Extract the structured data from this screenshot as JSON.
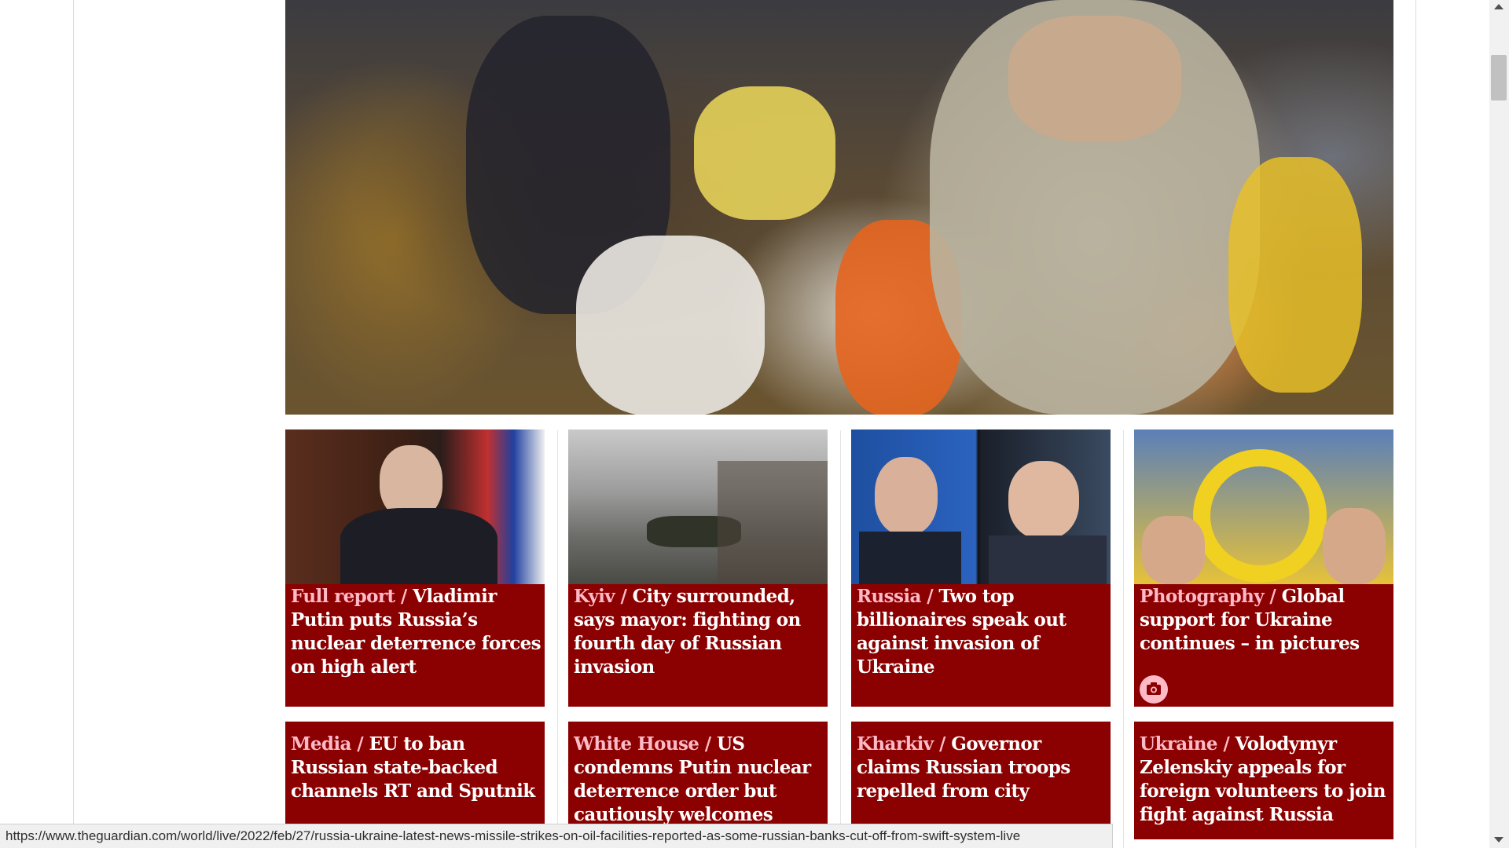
{
  "colors": {
    "card_background": "#8b0000",
    "kicker": "#ffbac8",
    "headline": "#ffffff"
  },
  "hero": {
    "image_description_icon": "photo-hero"
  },
  "cards_row1": [
    {
      "kicker": "Full report",
      "title": "Vladimir Putin puts Russia’s nuclear deterrence forces on high alert"
    },
    {
      "kicker": "Kyiv",
      "title": "City surrounded, says mayor: fighting on fourth day of Russian invasion"
    },
    {
      "kicker": "Russia",
      "title": "Two top billionaires speak out against invasion of Ukraine"
    },
    {
      "kicker": "Photography",
      "title": "Global support for Ukraine continues – in pictures"
    }
  ],
  "cards_row2": [
    {
      "kicker": "Media",
      "title": "EU to ban Russian state-backed channels RT and Sputnik"
    },
    {
      "kicker": "White House",
      "title": "US condemns Putin nuclear deterrence order but cautiously welcomes talks"
    },
    {
      "kicker": "Kharkiv",
      "title": "Governor claims Russian troops repelled from city"
    },
    {
      "kicker": "Ukraine",
      "title": "Volodymyr Zelenskiy appeals for foreign volunteers to join fight against Russia"
    }
  ],
  "status_url": "https://www.theguardian.com/world/live/2022/feb/27/russia-ukraine-latest-news-missile-strikes-on-oil-facilities-reported-as-some-russian-banks-cut-off-from-swift-system-live"
}
